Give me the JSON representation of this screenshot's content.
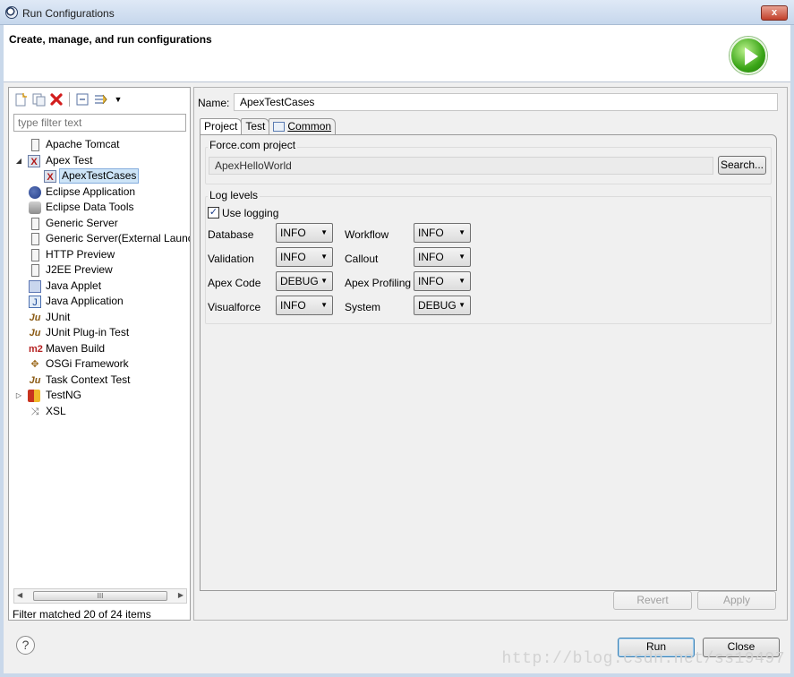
{
  "window": {
    "title": "Run Configurations",
    "close_label": "x"
  },
  "header": {
    "heading": "Create, manage, and run configurations"
  },
  "left": {
    "filter_placeholder": "type filter text",
    "tree": [
      {
        "label": "Apache Tomcat"
      },
      {
        "label": "Apex Test"
      },
      {
        "label": "ApexTestCases"
      },
      {
        "label": "Eclipse Application"
      },
      {
        "label": "Eclipse Data Tools"
      },
      {
        "label": "Generic Server"
      },
      {
        "label": "Generic Server(External Launc"
      },
      {
        "label": "HTTP Preview"
      },
      {
        "label": "J2EE Preview"
      },
      {
        "label": "Java Applet"
      },
      {
        "label": "Java Application"
      },
      {
        "label": "JUnit"
      },
      {
        "label": "JUnit Plug-in Test"
      },
      {
        "label": "Maven Build"
      },
      {
        "label": "OSGi Framework"
      },
      {
        "label": "Task Context Test"
      },
      {
        "label": "TestNG"
      },
      {
        "label": "XSL"
      }
    ],
    "icons": {
      "junit": "Ju",
      "maven": "m2",
      "task_context": "Ju"
    },
    "scroll_thumb_label": "III",
    "match_text": "Filter matched 20 of 24 items"
  },
  "config": {
    "name_label": "Name:",
    "name_value": "ApexTestCases",
    "tabs": [
      "Project",
      "Test",
      "Common"
    ],
    "project_group_title": "Force.com project",
    "project_value": "ApexHelloWorld",
    "search_button": "Search...",
    "log_group_title": "Log levels",
    "use_logging_label": "Use logging",
    "use_logging_checked": true,
    "levels": [
      {
        "label": "Database",
        "value": "INFO"
      },
      {
        "label": "Workflow",
        "value": "INFO"
      },
      {
        "label": "Validation",
        "value": "INFO"
      },
      {
        "label": "Callout",
        "value": "INFO"
      },
      {
        "label": "Apex Code",
        "value": "DEBUG"
      },
      {
        "label": "Apex Profiling",
        "value": "INFO"
      },
      {
        "label": "Visualforce",
        "value": "INFO"
      },
      {
        "label": "System",
        "value": "DEBUG"
      }
    ],
    "revert_button": "Revert",
    "apply_button": "Apply"
  },
  "footer": {
    "run_button": "Run",
    "close_button": "Close",
    "help_label": "?"
  },
  "watermark": "http://blog.csdn.net/ss19497"
}
